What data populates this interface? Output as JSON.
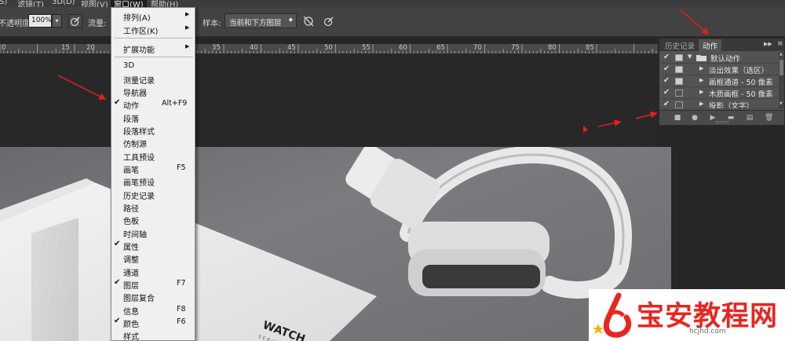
{
  "menubar": {
    "items": [
      "S)",
      "滤镜(T)",
      "3D(D)",
      "视图(V)",
      "窗口(W)",
      "帮助(H)"
    ]
  },
  "options": {
    "opacity_label": "不透明度:",
    "opacity_value": "100%",
    "flow_label": "流量:",
    "sample_label": "样本:",
    "sample_value": "当前和下方图层"
  },
  "ruler": {
    "ticks": [
      "0",
      "15",
      "20",
      "35",
      "40",
      "45",
      "50",
      "55",
      "60",
      "65",
      "70",
      "75",
      "80",
      "85"
    ]
  },
  "window_menu": {
    "items": [
      {
        "label": "排列(A)",
        "submenu": true
      },
      {
        "label": "工作区(K)",
        "submenu": true
      },
      {
        "label": "扩展功能",
        "submenu": true
      },
      {
        "label": "3D"
      },
      {
        "label": "测量记录"
      },
      {
        "label": "导航器"
      },
      {
        "label": "动作",
        "checked": true,
        "shortcut": "Alt+F9"
      },
      {
        "label": "段落"
      },
      {
        "label": "段落样式"
      },
      {
        "label": "仿制源"
      },
      {
        "label": "工具预设"
      },
      {
        "label": "画笔",
        "shortcut": "F5"
      },
      {
        "label": "画笔预设"
      },
      {
        "label": "历史记录"
      },
      {
        "label": "路径"
      },
      {
        "label": "色板"
      },
      {
        "label": "时间轴"
      },
      {
        "label": "属性",
        "checked": true
      },
      {
        "label": "调整"
      },
      {
        "label": "通道"
      },
      {
        "label": "图层",
        "checked": true,
        "shortcut": "F7"
      },
      {
        "label": "图层复合"
      },
      {
        "label": "信息",
        "shortcut": "F8"
      },
      {
        "label": "颜色",
        "checked": true,
        "shortcut": "F6"
      },
      {
        "label": "样式"
      }
    ]
  },
  "actions_panel": {
    "tabs": [
      "历史记录",
      "动作"
    ],
    "rows": [
      {
        "label": "默认动作",
        "kind": "folder"
      },
      {
        "label": "淡出效果（选区）",
        "kind": "action"
      },
      {
        "label": "画框通道 - 50 像素",
        "kind": "action"
      },
      {
        "label": "木质画框 - 50 像素",
        "kind": "action"
      },
      {
        "label": "投影（文字）",
        "kind": "action"
      }
    ]
  },
  "photo": {
    "brand_text": "WATCH",
    "series_text": "SERIES"
  },
  "watermark": {
    "text": "宝安教程网",
    "url": "hcjhd.com"
  },
  "colors": {
    "arrow": "#e02020",
    "watermark": "#e8261f"
  }
}
